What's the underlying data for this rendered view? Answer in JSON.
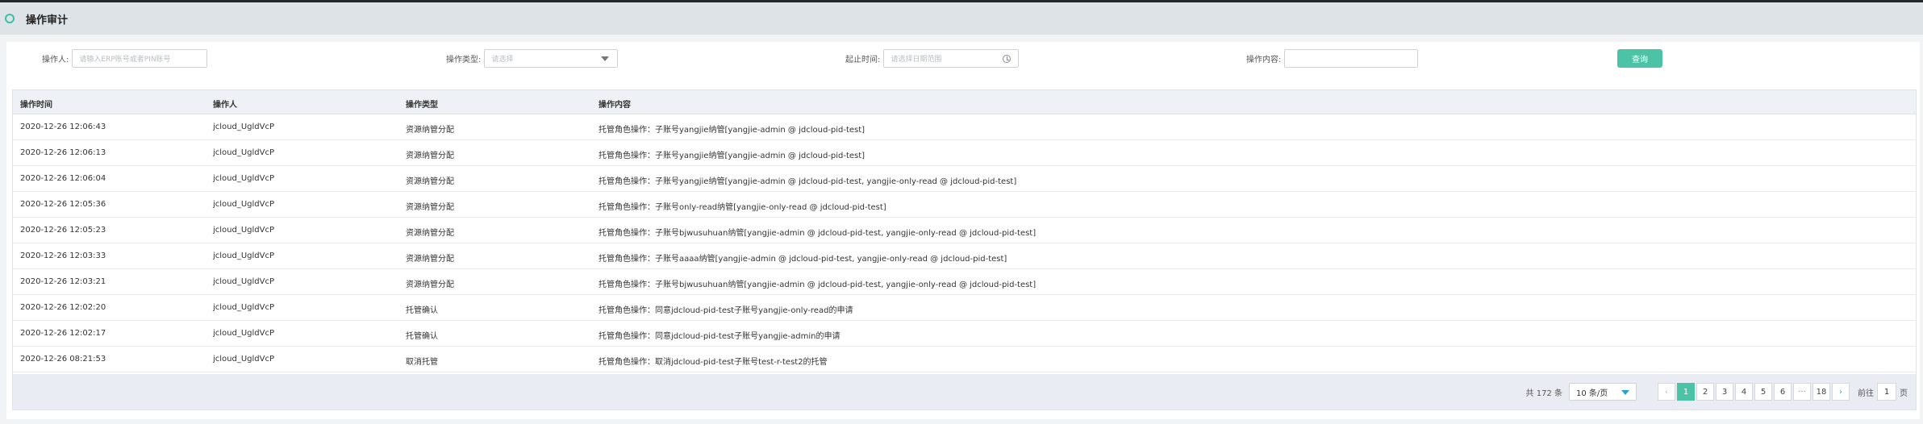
{
  "header": {
    "title": "操作审计"
  },
  "filters": {
    "operator": {
      "label": "操作人:",
      "placeholder": "请输入ERP账号或者PIN账号"
    },
    "type": {
      "label": "操作类型:",
      "placeholder": "请选择"
    },
    "time": {
      "label": "起止时间:",
      "placeholder": "请选择日期范围"
    },
    "content": {
      "label": "操作内容:",
      "value": ""
    },
    "query_label": "查询"
  },
  "table": {
    "headers": [
      "操作时间",
      "操作人",
      "操作类型",
      "操作内容"
    ],
    "rows": [
      [
        "2020-12-26 12:06:43",
        "jcloud_UgldVcP",
        "资源纳管分配",
        "托管角色操作：子账号yangjie纳管[yangjie-admin @ jdcloud-pid-test]"
      ],
      [
        "2020-12-26 12:06:13",
        "jcloud_UgldVcP",
        "资源纳管分配",
        "托管角色操作：子账号yangjie纳管[yangjie-admin @ jdcloud-pid-test]"
      ],
      [
        "2020-12-26 12:06:04",
        "jcloud_UgldVcP",
        "资源纳管分配",
        "托管角色操作：子账号yangjie纳管[yangjie-admin @ jdcloud-pid-test, yangjie-only-read @ jdcloud-pid-test]"
      ],
      [
        "2020-12-26 12:05:36",
        "jcloud_UgldVcP",
        "资源纳管分配",
        "托管角色操作：子账号only-read纳管[yangjie-only-read @ jdcloud-pid-test]"
      ],
      [
        "2020-12-26 12:05:23",
        "jcloud_UgldVcP",
        "资源纳管分配",
        "托管角色操作：子账号bjwusuhuan纳管[yangjie-admin @ jdcloud-pid-test, yangjie-only-read @ jdcloud-pid-test]"
      ],
      [
        "2020-12-26 12:03:33",
        "jcloud_UgldVcP",
        "资源纳管分配",
        "托管角色操作：子账号aaaa纳管[yangjie-admin @ jdcloud-pid-test, yangjie-only-read @ jdcloud-pid-test]"
      ],
      [
        "2020-12-26 12:03:21",
        "jcloud_UgldVcP",
        "资源纳管分配",
        "托管角色操作：子账号bjwusuhuan纳管[yangjie-admin @ jdcloud-pid-test, yangjie-only-read @ jdcloud-pid-test]"
      ],
      [
        "2020-12-26 12:02:20",
        "jcloud_UgldVcP",
        "托管确认",
        "托管角色操作：同意jdcloud-pid-test子账号yangjie-only-read的申请"
      ],
      [
        "2020-12-26 12:02:17",
        "jcloud_UgldVcP",
        "托管确认",
        "托管角色操作：同意jdcloud-pid-test子账号yangjie-admin的申请"
      ],
      [
        "2020-12-26 08:21:53",
        "jcloud_UgldVcP",
        "取消托管",
        "托管角色操作：取消jdcloud-pid-test子账号test-r-test2的托管"
      ]
    ]
  },
  "pagination": {
    "total": "共 172 条",
    "page_size": "10 条/页",
    "prev_icon": "chevron-left-icon",
    "next_icon": "chevron-right-icon",
    "pages": [
      "1",
      "2",
      "3",
      "4",
      "5",
      "6",
      "···",
      "18"
    ],
    "current": "1",
    "goto_label": "前往",
    "goto_value": "1",
    "page_suffix": "页"
  },
  "colors": {
    "accent": "#4cc3a7",
    "header_bg": "#dde3e7",
    "link": "#2a9fd6"
  }
}
